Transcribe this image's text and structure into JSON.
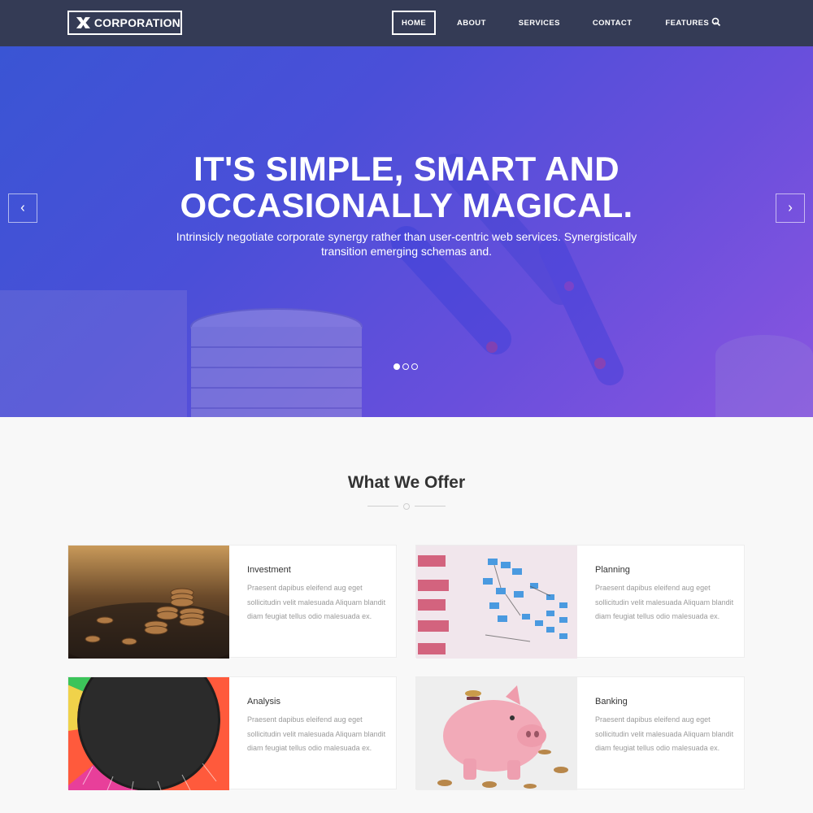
{
  "brand": {
    "logo_text": "CORPORATION",
    "logo_icon": "x-logo-icon"
  },
  "nav": {
    "items": [
      {
        "label": "HOME",
        "active": true
      },
      {
        "label": "ABOUT"
      },
      {
        "label": "SERVICES"
      },
      {
        "label": "CONTACT"
      },
      {
        "label": "FEATURES",
        "icon": "chevron-down-icon"
      }
    ],
    "search_icon": "search-icon"
  },
  "hero": {
    "title_line1": "IT'S SIMPLE, SMART AND",
    "title_line2": "OCCASIONALLY MAGICAL.",
    "subtitle": "Intrinsicly negotiate corporate synergy rather than user-centric web services. Synergistically transition emerging schemas and.",
    "prev_icon": "chevron-left-icon",
    "next_icon": "chevron-right-icon",
    "slide_count": 3,
    "active_slide": 1
  },
  "offer": {
    "title": "What We Offer",
    "cards": [
      {
        "title": "Investment",
        "text": "Praesent dapibus eleifend aug eget sollicitudin velit malesuada Aliquam blandit diam feugiat tellus odio malesuada ex."
      },
      {
        "title": "Planning",
        "text": "Praesent dapibus eleifend aug eget sollicitudin velit malesuada Aliquam blandit diam feugiat tellus odio malesuada ex."
      },
      {
        "title": "Analysis",
        "text": "Praesent dapibus eleifend aug eget sollicitudin velit malesuada Aliquam blandit diam feugiat tellus odio malesuada ex."
      },
      {
        "title": "Banking",
        "text": "Praesent dapibus eleifend aug eget sollicitudin velit malesuada Aliquam blandit diam feugiat tellus odio malesuada ex."
      }
    ]
  },
  "colors": {
    "nav_bg": "#343b55",
    "hero_start": "#3a55d4",
    "hero_end": "#8a55e0",
    "page_bg": "#f8f8f8"
  }
}
